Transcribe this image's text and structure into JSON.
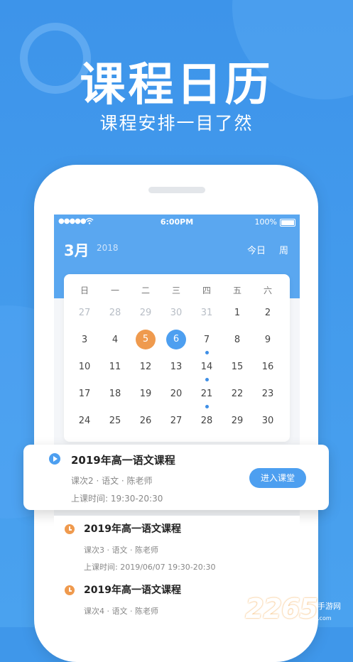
{
  "hero": {
    "title": "课程日历",
    "subtitle": "课程安排一目了然"
  },
  "status_bar": {
    "signal": "●●●●●",
    "time": "6:00PM",
    "battery": "100%"
  },
  "calendar": {
    "month": "3月",
    "year": "2018",
    "today_label": "今日",
    "week_label": "周",
    "weekdays": [
      "日",
      "一",
      "二",
      "三",
      "四",
      "五",
      "六"
    ],
    "weeks": [
      [
        "27",
        "28",
        "29",
        "30",
        "31",
        "1",
        "2"
      ],
      [
        "3",
        "4",
        "5",
        "6",
        "7",
        "8",
        "9"
      ],
      [
        "10",
        "11",
        "12",
        "13",
        "14",
        "15",
        "16"
      ],
      [
        "17",
        "18",
        "19",
        "20",
        "21",
        "22",
        "23"
      ],
      [
        "24",
        "25",
        "26",
        "27",
        "28",
        "29",
        "30"
      ]
    ]
  },
  "highlighted_course": {
    "title": "2019年高一语文课程",
    "meta": "课次2 · 语文 · 陈老师",
    "time": "上课时间: 19:30-20:30",
    "action": "进入课堂"
  },
  "courses": [
    {
      "title": "2019年高一语文课程",
      "meta": "课次3 · 语文 · 陈老师",
      "time": "上课时间: 2019/06/07 19:30-20:30"
    },
    {
      "title": "2019年高一语文课程",
      "meta": "课次4 · 语文 · 陈老师",
      "time": ""
    }
  ],
  "watermark": {
    "number": "2265",
    "text": "手游网",
    "domain": ".com"
  },
  "colors": {
    "primary": "#4d9ff0",
    "accent": "#ef9a4e",
    "background": "#3f97ea"
  },
  "icons": {
    "play": "play-icon",
    "clock": "clock-icon",
    "wifi": "wifi-icon",
    "battery": "battery-icon"
  }
}
